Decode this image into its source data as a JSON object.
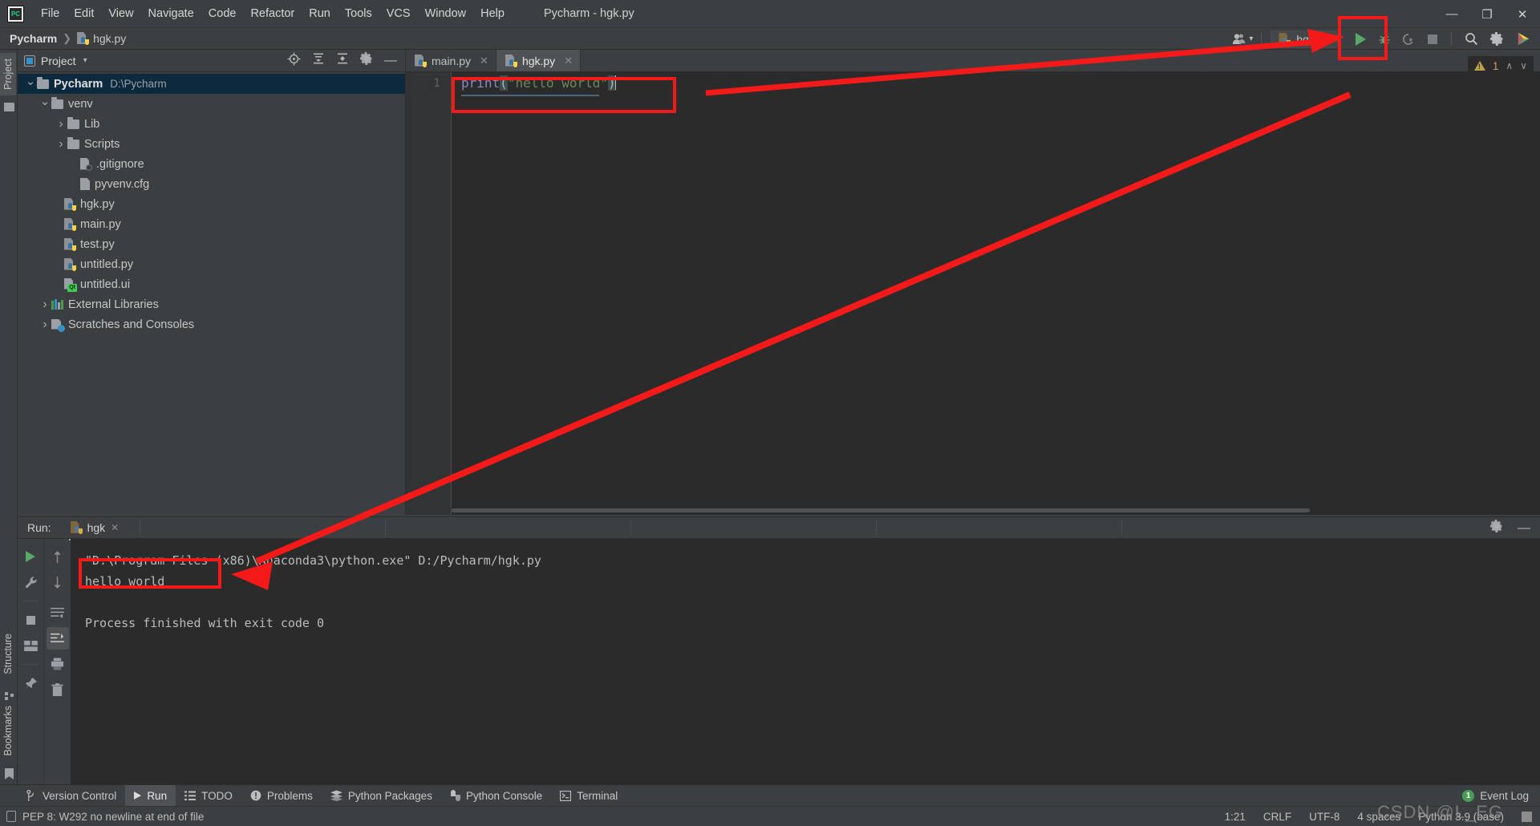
{
  "window": {
    "title": "Pycharm - hgk.py",
    "minimize_label": "—",
    "maximize_label": "❐",
    "close_label": "✕"
  },
  "menu": {
    "items": [
      "File",
      "Edit",
      "View",
      "Navigate",
      "Code",
      "Refactor",
      "Run",
      "Tools",
      "VCS",
      "Window",
      "Help"
    ]
  },
  "breadcrumb": {
    "project": "Pycharm",
    "separator": "❯",
    "file": "hgk.py"
  },
  "toolbar": {
    "run_config_name": "hgk",
    "run_config_caret": "▾",
    "user_caret": "▾",
    "icons": {
      "user": "user-icon",
      "run": "run-icon",
      "debug": "debug-icon",
      "coverage": "coverage-icon",
      "stop": "stop-icon",
      "search": "search-icon",
      "settings": "settings-icon",
      "updates": "updates-icon"
    }
  },
  "left_stripe": {
    "project_tab": "Project",
    "structure_tab": "Structure",
    "bookmarks_tab": "Bookmarks"
  },
  "project_panel": {
    "title": "Project",
    "caret": "▾",
    "tree": [
      {
        "label": "Pycharm",
        "path": "D:\\Pycharm",
        "icon": "folder-icon",
        "indent": 0,
        "chevron": "down",
        "bold": true,
        "selected": true
      },
      {
        "label": "venv",
        "path": "",
        "icon": "folder-icon",
        "indent": 1,
        "chevron": "down",
        "bold": false,
        "selected": false
      },
      {
        "label": "Lib",
        "path": "",
        "icon": "folder-icon",
        "indent": 2,
        "chevron": "right",
        "bold": false,
        "selected": false
      },
      {
        "label": "Scripts",
        "path": "",
        "icon": "folder-icon",
        "indent": 2,
        "chevron": "right",
        "bold": false,
        "selected": false
      },
      {
        "label": ".gitignore",
        "path": "",
        "icon": "gitignore-icon",
        "indent": 3,
        "chevron": "none",
        "bold": false,
        "selected": false
      },
      {
        "label": "pyvenv.cfg",
        "path": "",
        "icon": "config-file-icon",
        "indent": 3,
        "chevron": "none",
        "bold": false,
        "selected": false
      },
      {
        "label": "hgk.py",
        "path": "",
        "icon": "python-file-icon",
        "indent": 2,
        "chevron": "none",
        "bold": false,
        "selected": false
      },
      {
        "label": "main.py",
        "path": "",
        "icon": "python-file-icon",
        "indent": 2,
        "chevron": "none",
        "bold": false,
        "selected": false
      },
      {
        "label": "test.py",
        "path": "",
        "icon": "python-file-icon",
        "indent": 2,
        "chevron": "none",
        "bold": false,
        "selected": false
      },
      {
        "label": "untitled.py",
        "path": "",
        "icon": "python-file-icon",
        "indent": 2,
        "chevron": "none",
        "bold": false,
        "selected": false
      },
      {
        "label": "untitled.ui",
        "path": "",
        "icon": "qt-ui-file-icon",
        "indent": 2,
        "chevron": "none",
        "bold": false,
        "selected": false
      },
      {
        "label": "External Libraries",
        "path": "",
        "icon": "libraries-icon",
        "indent": 0,
        "chevron": "right",
        "bold": false,
        "selected": false
      },
      {
        "label": "Scratches and Consoles",
        "path": "",
        "icon": "scratches-icon",
        "indent": 0,
        "chevron": "right",
        "bold": false,
        "selected": false
      }
    ]
  },
  "editor": {
    "tabs": [
      {
        "label": "main.py",
        "active": false,
        "close": "✕"
      },
      {
        "label": "hgk.py",
        "active": true,
        "close": "✕"
      }
    ],
    "line_number": "1",
    "code": {
      "fn": "print",
      "open_paren": "(",
      "string": "\"hello world\"",
      "close_paren": ")"
    },
    "inspection": {
      "warning_count": "1",
      "up_caret": "∧",
      "down_caret": "∨"
    }
  },
  "run_panel": {
    "run_label": "Run:",
    "tab_label": "hgk",
    "tab_close": "✕",
    "console_lines": [
      "\"D:\\Program Files (x86)\\Anaconda3\\python.exe\" D:/Pycharm/hgk.py",
      "hello world",
      "",
      "Process finished with exit code 0"
    ]
  },
  "bottom_tabs": [
    {
      "label": "Version Control",
      "icon": "branch-icon",
      "active": false
    },
    {
      "label": "Run",
      "icon": "run-icon",
      "active": true
    },
    {
      "label": "TODO",
      "icon": "todo-icon",
      "active": false
    },
    {
      "label": "Problems",
      "icon": "problems-icon",
      "active": false
    },
    {
      "label": "Python Packages",
      "icon": "packages-icon",
      "active": false
    },
    {
      "label": "Python Console",
      "icon": "python-icon",
      "active": false
    },
    {
      "label": "Terminal",
      "icon": "terminal-icon",
      "active": false
    }
  ],
  "event_log": {
    "count": "1",
    "label": "Event Log"
  },
  "status_bar": {
    "message": "PEP 8: W292 no newline at end of file",
    "caret_position": "1:21",
    "line_separator": "CRLF",
    "encoding": "UTF-8",
    "indent": "4 spaces",
    "interpreter": "Python 3.9 (base)"
  },
  "watermark": "CSDN @L_EG",
  "colors": {
    "accent_green": "#59a869",
    "annotation_red": "#f41a1a",
    "selection_blue": "#0d293e",
    "string_green": "#6a8759",
    "keyword_purple": "#8888c6"
  }
}
